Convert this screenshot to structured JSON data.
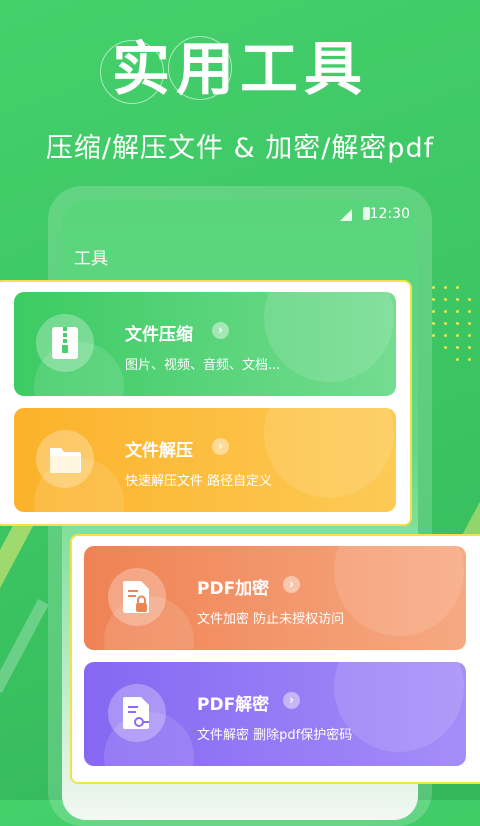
{
  "header": {
    "title": "实用工具",
    "subtitle": "压缩/解压文件 & 加密/解密pdf"
  },
  "status_bar": {
    "time": "12:30"
  },
  "screen": {
    "section_label": "工具"
  },
  "cards": [
    {
      "title": "文件压缩",
      "desc": "图片、视频、音频、文档...",
      "icon": "zip-file-icon",
      "color_start": "#3ccb63",
      "color_end": "#6dd98a"
    },
    {
      "title": "文件解压",
      "desc": "快速解压文件 路径自定义",
      "icon": "folder-icon",
      "color_start": "#fcb52b",
      "color_end": "#fdc84f"
    },
    {
      "title": "PDF加密",
      "desc": "文件加密 防止未授权访问",
      "icon": "pdf-lock-icon",
      "color_start": "#f08457",
      "color_end": "#f6a47d"
    },
    {
      "title": "PDF解密",
      "desc": "文件解密 删除pdf保护密码",
      "icon": "pdf-key-icon",
      "color_start": "#8a6bf2",
      "color_end": "#a28af7"
    }
  ],
  "colors": {
    "background": "#3cc462",
    "frame_border": "#f2e24a"
  }
}
